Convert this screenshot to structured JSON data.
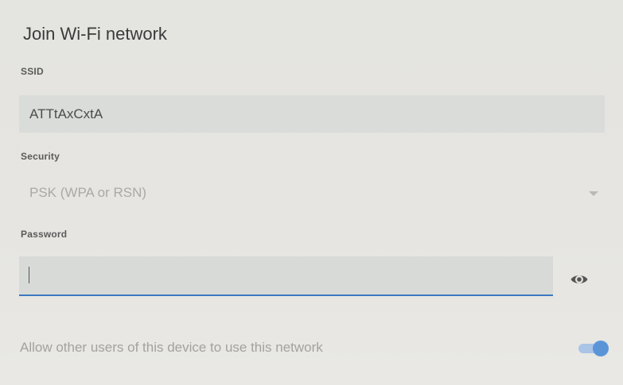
{
  "dialog": {
    "title": "Join Wi-Fi network"
  },
  "ssid": {
    "label": "SSID",
    "value": "ATTtAxCxtA"
  },
  "security": {
    "label": "Security",
    "selected": "PSK (WPA or RSN)"
  },
  "password": {
    "label": "Password",
    "value": "",
    "show_icon": "eye-icon"
  },
  "share": {
    "label": "Allow other users of this device to use this network",
    "enabled": true
  },
  "colors": {
    "accent": "#3c78c2",
    "toggle_knob": "#5b95d8"
  }
}
